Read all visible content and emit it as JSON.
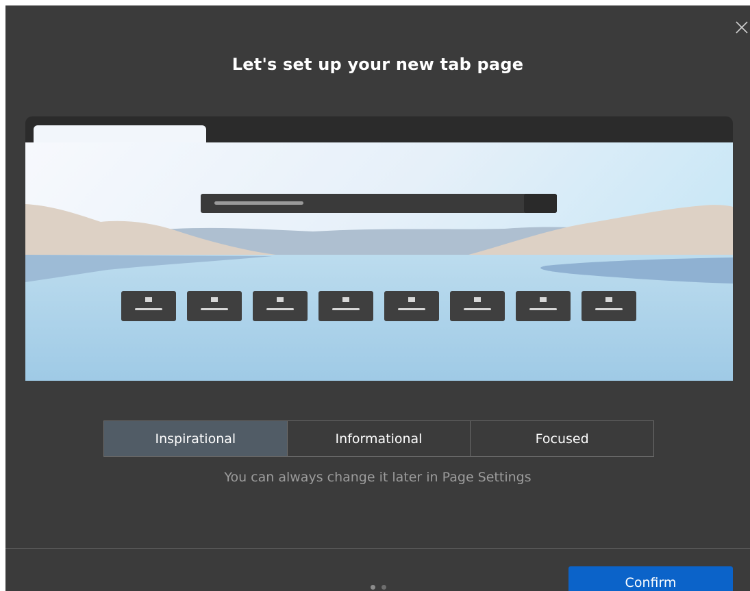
{
  "dialog": {
    "title": "Let's set up your new tab page",
    "close_icon": "close-icon"
  },
  "preview": {
    "description_icon": "new-tab-preview-illustration",
    "top_site_tiles": 8
  },
  "layout_options": {
    "items": [
      {
        "label": "Inspirational",
        "selected": true
      },
      {
        "label": "Informational",
        "selected": false
      },
      {
        "label": "Focused",
        "selected": false
      }
    ]
  },
  "hint": "You can always change it later in Page Settings",
  "pager": {
    "current": 1,
    "total": 2
  },
  "footer": {
    "confirm_label": "Confirm"
  },
  "colors": {
    "dialog_bg": "#3b3b3b",
    "selected_option_bg": "#515c66",
    "confirm_bg": "#0b63c9"
  }
}
